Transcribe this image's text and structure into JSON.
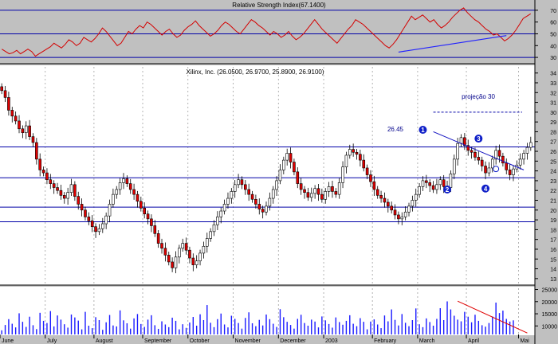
{
  "chart_data": [
    {
      "type": "line",
      "title": "Relative Strength Index(67.1400)",
      "yticks": [
        30,
        40,
        50,
        60,
        70
      ],
      "ylim": [
        26,
        76
      ],
      "levels": [
        70,
        50,
        30
      ],
      "grid": false,
      "series": [
        {
          "values": [
            37,
            35,
            33,
            34,
            36,
            33,
            35,
            37,
            35,
            31,
            33,
            35,
            37,
            39,
            42,
            40,
            38,
            41,
            45,
            43,
            40,
            42,
            47,
            45,
            43,
            46,
            50,
            55,
            52,
            48,
            44,
            40,
            42,
            47,
            52,
            50,
            54,
            57,
            55,
            60,
            58,
            55,
            52,
            49,
            52,
            54,
            50,
            47,
            49,
            53,
            56,
            58,
            61,
            57,
            54,
            51,
            48,
            50,
            53,
            57,
            60,
            58,
            55,
            52,
            50,
            54,
            58,
            62,
            60,
            57,
            55,
            52,
            49,
            52,
            50,
            47,
            49,
            52,
            48,
            45,
            47,
            50,
            54,
            58,
            62,
            58,
            54,
            51,
            48,
            45,
            42,
            46,
            50,
            54,
            57,
            62,
            60,
            58,
            55,
            52,
            49,
            46,
            43,
            40,
            38,
            41,
            45,
            50,
            55,
            60,
            65,
            62,
            64,
            66,
            63,
            60,
            62,
            58,
            55,
            57,
            60,
            64,
            67,
            70,
            72,
            68,
            65,
            62,
            60,
            57,
            54,
            52,
            49,
            50,
            47,
            44,
            46,
            49,
            53,
            58,
            63,
            65,
            67
          ]
        },
        {
          "values": [
            [
              114,
              34.5
            ],
            [
              145,
              48.5
            ]
          ]
        }
      ]
    },
    {
      "type": "candlestick",
      "title": "Xilinx, Inc. (26.0500, 26.9700, 25.8900, 26.9100)",
      "x_labels": [
        "June",
        "July",
        "August",
        "September",
        "October",
        "November",
        "December",
        "2003",
        "February",
        "March",
        "April",
        "Mai"
      ],
      "yticks": [
        13,
        14,
        15,
        16,
        17,
        18,
        19,
        20,
        21,
        22,
        23,
        24,
        25,
        26,
        27,
        28,
        29,
        30,
        31,
        32,
        33,
        34
      ],
      "ylim": [
        12.5,
        34.3
      ],
      "levels": [
        26.45,
        23.3,
        20.3,
        18.8
      ],
      "level_label": "26.45",
      "projection_label": "projeção 30",
      "projection_level": 30,
      "points": [
        {
          "label": "1",
          "x": 121,
          "y": 28.2
        },
        {
          "label": "2",
          "x": 128,
          "y": 22.1
        },
        {
          "label": "3",
          "x": 137,
          "y": 27.3
        },
        {
          "label": "4",
          "x": 139,
          "y": 22.2
        }
      ],
      "trendline": [
        [
          124,
          28.0
        ],
        [
          150,
          24.1
        ]
      ],
      "series": [
        {
          "name": "close",
          "values": [
            32.2,
            31.5,
            30.2,
            29.6,
            29.1,
            28.3,
            27.9,
            28.6,
            27.5,
            26.9,
            25.2,
            24.1,
            23.8,
            23.1,
            22.7,
            22.3,
            22.0,
            21.5,
            21.2,
            21.8,
            22.6,
            21.4,
            20.6,
            20.0,
            19.3,
            18.9,
            18.3,
            17.8,
            18.1,
            18.6,
            19.4,
            20.6,
            21.6,
            22.1,
            22.8,
            23.2,
            22.7,
            22.1,
            21.6,
            20.9,
            20.2,
            19.6,
            19.1,
            18.4,
            17.6,
            16.6,
            16.1,
            15.4,
            14.7,
            14.1,
            15.2,
            16.1,
            16.6,
            15.9,
            15.1,
            14.4,
            14.8,
            15.6,
            16.3,
            17.1,
            17.8,
            18.5,
            19.3,
            19.9,
            20.6,
            21.2,
            21.9,
            22.6,
            23.1,
            22.6,
            22.1,
            21.6,
            21.1,
            20.6,
            20.1,
            19.8,
            20.4,
            21.2,
            22.1,
            23.0,
            24.1,
            25.1,
            25.8,
            24.9,
            23.9,
            22.7,
            22.1,
            21.8,
            21.3,
            21.7,
            22.2,
            21.6,
            21.1,
            21.9,
            22.4,
            21.9,
            21.6,
            22.8,
            24.4,
            25.6,
            26.2,
            25.9,
            25.7,
            25.1,
            24.3,
            23.6,
            22.9,
            22.1,
            21.5,
            21.2,
            20.8,
            20.4,
            20.0,
            19.5,
            19.1,
            19.3,
            19.8,
            20.4,
            21.0,
            21.6,
            22.4,
            23.0,
            22.8,
            22.5,
            22.1,
            22.6,
            23.1,
            22.4,
            22.3,
            23.7,
            25.2,
            26.8,
            27.4,
            26.6,
            26.1,
            25.9,
            25.4,
            25.1,
            24.5,
            23.8,
            24.3,
            25.2,
            26.1,
            25.5,
            24.8,
            24.1,
            23.6,
            24.2,
            24.6,
            25.2,
            25.8,
            26.4,
            26.9
          ]
        },
        {
          "name": "volume",
          "values": [
            8200,
            10400,
            12800,
            10900,
            9400,
            15200,
            11700,
            9600,
            13800,
            10300,
            8700,
            15400,
            12100,
            11200,
            16100,
            9800,
            14300,
            12600,
            10700,
            9300,
            14700,
            13500,
            12200,
            8600,
            15800,
            10100,
            9100,
            13600,
            12400,
            8400,
            11500,
            14500,
            10200,
            9800,
            16400,
            12300,
            11100,
            8900,
            13100,
            14900,
            10800,
            9600,
            12600,
            14400,
            10300,
            8800,
            11900,
            10600,
            9500,
            13400,
            12100,
            8600,
            10700,
            9200,
            11400,
            13700,
            10100,
            14800,
            12400,
            18600,
            11300,
            9500,
            12800,
            15100,
            10600,
            9400,
            14200,
            12900,
            11200,
            8900,
            13300,
            15600,
            11100,
            9900,
            12500,
            10200,
            14700,
            12800,
            10900,
            9600,
            16900,
            13600,
            11700,
            10400,
            8900,
            12900,
            14600,
            11200,
            10100,
            12600,
            11800,
            9400,
            13900,
            12300,
            10800,
            9300,
            13500,
            11600,
            10500,
            12100,
            14400,
            10900,
            9900,
            13200,
            11700,
            8600,
            11800,
            12700,
            10600,
            9100,
            14300,
            11900,
            16800,
            12500,
            10200,
            14900,
            11300,
            9900,
            12400,
            17200,
            10700,
            9500,
            13100,
            11600,
            10100,
            12900,
            17300,
            12400,
            20100,
            16800,
            14200,
            12600,
            11900,
            15800,
            13800,
            11500,
            14600,
            12100,
            10300,
            9700,
            11200,
            13900,
            19600,
            15300,
            16300,
            12900,
            11800,
            12300
          ]
        }
      ],
      "volume_yticks": [
        10000,
        15000,
        20000,
        25000
      ],
      "volume_ylim": [
        6500,
        25500
      ],
      "volume_trendline": [
        [
          131,
          20200
        ],
        [
          151,
          7100
        ]
      ]
    }
  ],
  "colors": {
    "background": "#c0c0c0",
    "plot": "#ffffff",
    "rsi_line": "#d40000",
    "level_line": "#0000a8",
    "up_candle": "#ffffff",
    "down_candle": "#e00000",
    "volume_bar": "#1a1aff",
    "trend": "#2020ff"
  }
}
